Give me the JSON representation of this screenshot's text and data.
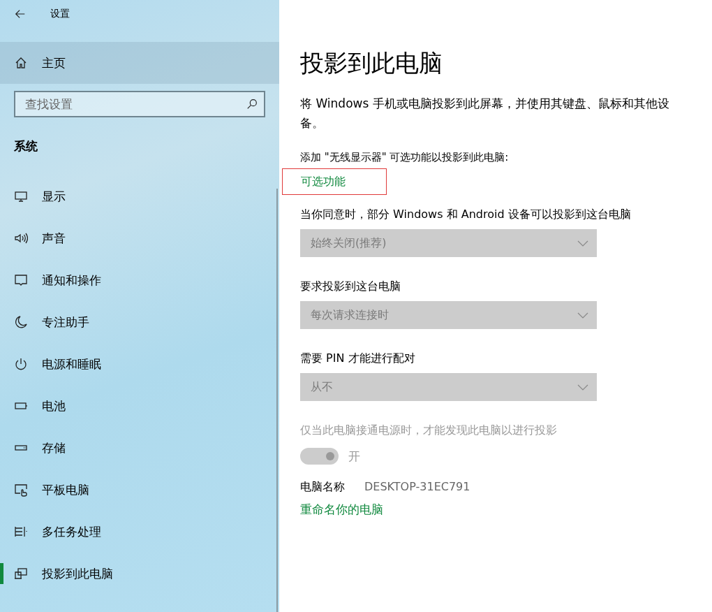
{
  "window": {
    "title": "设置"
  },
  "sidebar": {
    "home": "主页",
    "search": {
      "placeholder": "查找设置"
    },
    "section": "系统",
    "items": [
      {
        "label": "显示",
        "selected": false
      },
      {
        "label": "声音",
        "selected": false
      },
      {
        "label": "通知和操作",
        "selected": false
      },
      {
        "label": "专注助手",
        "selected": false
      },
      {
        "label": "电源和睡眠",
        "selected": false
      },
      {
        "label": "电池",
        "selected": false
      },
      {
        "label": "存储",
        "selected": false
      },
      {
        "label": "平板电脑",
        "selected": false
      },
      {
        "label": "多任务处理",
        "selected": false
      },
      {
        "label": "投影到此电脑",
        "selected": true
      }
    ]
  },
  "page": {
    "title": "投影到此电脑",
    "description": "将 Windows 手机或电脑投影到此屏幕，并使用其键盘、鼠标和其他设备。",
    "add_label": "添加 \"无线显示器\" 可选功能以投影到此电脑:",
    "add_link": {
      "label": "可选功能",
      "focused": true
    },
    "settings": [
      {
        "kind": "dropdown",
        "label": "当你同意时，部分 Windows 和 Android 设备可以投影到这台电脑",
        "value": "始终关闭(推荐)",
        "disabled": true
      },
      {
        "kind": "dropdown",
        "label": "要求投影到这台电脑",
        "value": "每次请求连接时",
        "disabled": true
      },
      {
        "kind": "dropdown",
        "label": "需要 PIN 才能进行配对",
        "value": "从不",
        "disabled": true
      },
      {
        "kind": "toggle",
        "label": "仅当此电脑接通电源时，才能发现此电脑以进行投影",
        "on": true,
        "state_text": "开",
        "disabled": true
      }
    ],
    "pc_name_label": "电脑名称",
    "pc_name": "DESKTOP-31EC791",
    "rename_link": "重命名你的电脑"
  }
}
